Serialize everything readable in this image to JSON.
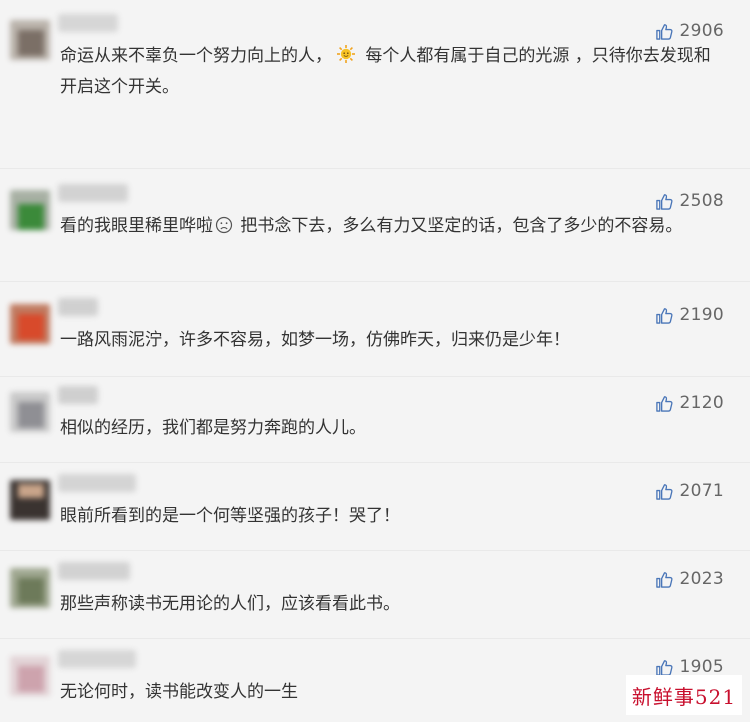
{
  "comments": [
    {
      "likes": "2906",
      "text_a": "命运从来不辜负一个努力向上的人，",
      "emoji": "sun-emoji",
      "text_b": " 每个人都有属于自己的光源 ，只待你去发现和开启这个开关。"
    },
    {
      "likes": "2508",
      "text_a": "看的我眼里稀里哗啦",
      "emoji": "sad-face-emoji",
      "text_b": " 把书念下去，多么有力又坚定的话，包含了多少的不容易。"
    },
    {
      "likes": "2190",
      "text": " 一路风雨泥泞，许多不容易，如梦一场，仿佛昨天，归来仍是少年！"
    },
    {
      "likes": "2120",
      "text": "相似的经历，我们都是努力奔跑的人儿。"
    },
    {
      "likes": "2071",
      "text": "眼前所看到的是一个何等坚强的孩子！哭了！"
    },
    {
      "likes": "2023",
      "text": "那些声称读书无用论的人们，应该看看此书。"
    },
    {
      "likes": "1905",
      "text": "无论何时，读书能改变人的一生"
    }
  ],
  "watermark": "新鲜事521",
  "colors": {
    "text": "#333333",
    "count": "#666666",
    "like_icon": "#4a76b8",
    "watermark": "#c8102e"
  }
}
